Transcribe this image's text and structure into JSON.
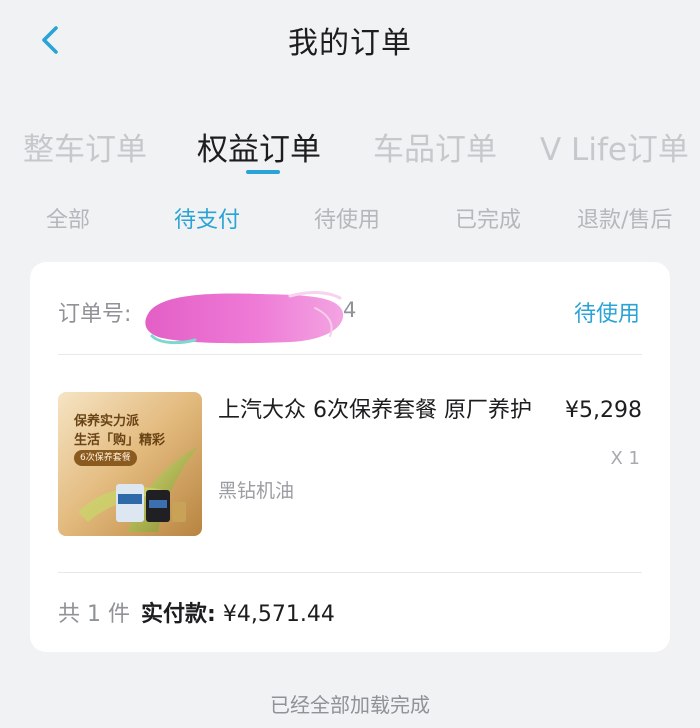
{
  "header": {
    "title": "我的订单",
    "back_icon": "chevron-left-icon"
  },
  "main_tabs": [
    {
      "label": "整车订单",
      "active": false
    },
    {
      "label": "权益订单",
      "active": true
    },
    {
      "label": "车品订单",
      "active": false
    },
    {
      "label": "V Life订单",
      "active": false
    }
  ],
  "sub_tabs": [
    {
      "label": "全部",
      "active": false
    },
    {
      "label": "待支付",
      "active": true
    },
    {
      "label": "待使用",
      "active": false
    },
    {
      "label": "已完成",
      "active": false
    },
    {
      "label": "退款/售后",
      "active": false
    }
  ],
  "order": {
    "order_no_label": "订单号:",
    "order_no_visible_fragment": "4",
    "status": "待使用",
    "product": {
      "name": "上汽大众 6次保养套餐 原厂养护",
      "spec": "黑钻机油",
      "price": "¥5,298",
      "quantity": "X 1",
      "thumb_line1": "保养实力派",
      "thumb_line2": "生活「购」精彩",
      "thumb_badge": "6次保养套餐"
    },
    "summary": {
      "count_prefix": "共",
      "count": "1",
      "count_suffix": "件",
      "paid_label": "实付款:",
      "paid_amount": "¥4,571.44"
    }
  },
  "footer": {
    "note": "已经全部加载完成"
  },
  "colors": {
    "accent": "#2aa3d6",
    "background": "#f1f2f4",
    "card": "#ffffff",
    "text_primary": "#1d1d1f",
    "text_muted": "#8f9297",
    "tab_inactive": "#c6c8cc",
    "redaction": "#ea6fd1"
  }
}
